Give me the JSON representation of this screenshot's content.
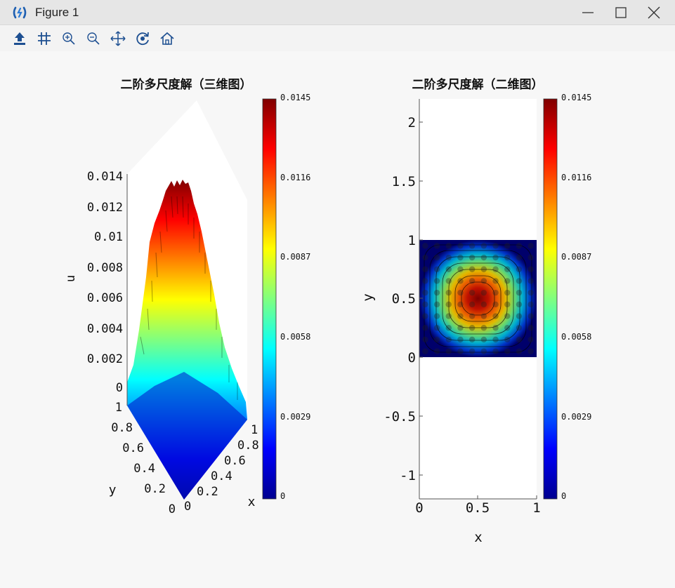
{
  "window": {
    "title": "Figure 1",
    "controls": [
      "minimize",
      "maximize",
      "close"
    ]
  },
  "toolbar": {
    "icons": [
      "save-icon",
      "grid-icon",
      "zoom-in-icon",
      "zoom-out-icon",
      "pan-icon",
      "rotate-icon",
      "home-icon"
    ]
  },
  "colormap": "jet",
  "chart_data": [
    {
      "type": "surface",
      "title": "二阶多尺度解（三维图）",
      "xlabel": "x",
      "ylabel": "y",
      "zlabel": "u",
      "xlim": [
        0,
        1
      ],
      "ylim": [
        0,
        1
      ],
      "zlim": [
        0,
        0.0145
      ],
      "x_ticks": [
        "0",
        "0.2",
        "0.4",
        "0.6",
        "0.8",
        "1"
      ],
      "y_ticks": [
        "0",
        "0.2",
        "0.4",
        "0.6",
        "0.8",
        "1"
      ],
      "z_ticks": [
        "0",
        "0.002",
        "0.004",
        "0.006",
        "0.008",
        "0.01",
        "0.012",
        "0.014"
      ],
      "colorbar_ticks": [
        "0",
        "0.0029",
        "0.0058",
        "0.0087",
        "0.0116",
        "0.0145"
      ]
    },
    {
      "type": "heatmap",
      "title": "二阶多尺度解（二维图）",
      "xlabel": "x",
      "ylabel": "y",
      "xlim": [
        0,
        1
      ],
      "ylim": [
        -1.2,
        2.2
      ],
      "x_ticks": [
        "0",
        "0.5",
        "1"
      ],
      "y_ticks": [
        "-1",
        "-0.5",
        "0",
        "0.5",
        "1",
        "1.5",
        "2"
      ],
      "data_extent": {
        "x": [
          0,
          1
        ],
        "y": [
          0,
          1
        ]
      },
      "peak": {
        "x": 0.5,
        "y": 0.5,
        "value": 0.0145
      },
      "colorbar_ticks": [
        "0",
        "0.0029",
        "0.0058",
        "0.0087",
        "0.0116",
        "0.0145"
      ]
    }
  ]
}
